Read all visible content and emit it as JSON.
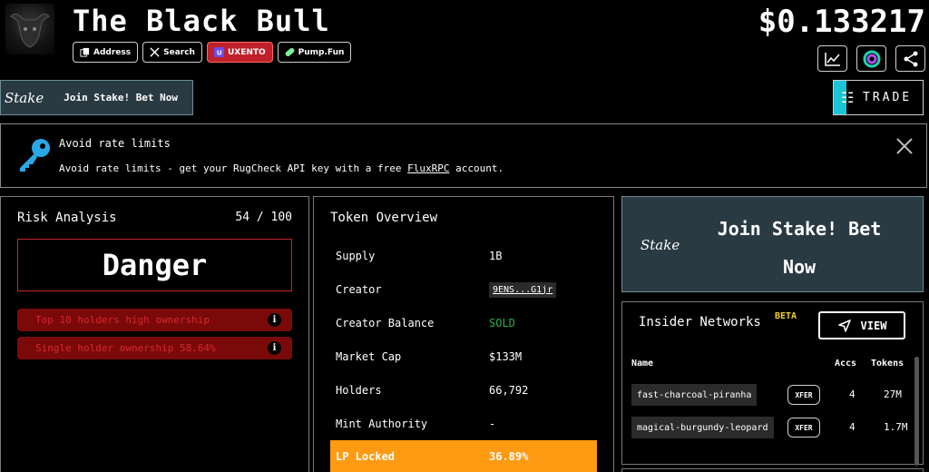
{
  "header": {
    "title": "The Black Bull",
    "price": "$0.133217",
    "chips": [
      {
        "label": "Address",
        "icon": "copy-icon"
      },
      {
        "label": "Search",
        "icon": "x-logo-icon"
      },
      {
        "label": "UXENTO",
        "icon": "uxento-logo-icon"
      },
      {
        "label": "Pump.Fun",
        "icon": "pill-icon"
      }
    ],
    "icon_buttons": [
      "chart-icon",
      "ring-logo-icon",
      "share-icon"
    ]
  },
  "stake_banner_small": {
    "logo": "Stake",
    "text": "Join Stake! Bet Now"
  },
  "trade_button": {
    "label": "TRADE"
  },
  "notice": {
    "title": "Avoid rate limits",
    "body_prefix": "Avoid rate limits - get your RugCheck API key with a free ",
    "link": "FluxRPC",
    "body_suffix": " account."
  },
  "risk": {
    "title": "Risk Analysis",
    "score": "54 / 100",
    "level": "Danger",
    "warnings": [
      "Top 10 holders high ownership",
      "Single holder ownership 58.64%"
    ]
  },
  "overview": {
    "title": "Token Overview",
    "rows": [
      {
        "key": "Supply",
        "value": "1B"
      },
      {
        "key": "Creator",
        "value": "9ENS...G1jr"
      },
      {
        "key": "Creator Balance",
        "value": "SOLD"
      },
      {
        "key": "Market Cap",
        "value": "$133M"
      },
      {
        "key": "Holders",
        "value": "66,792"
      },
      {
        "key": "Mint Authority",
        "value": "-"
      },
      {
        "key": "LP Locked",
        "value": "36.89%"
      }
    ]
  },
  "stake_banner_big": {
    "logo": "Stake",
    "text": "Join Stake! Bet Now"
  },
  "insider": {
    "title": "Insider Networks",
    "beta": "BETA",
    "view_label": "VIEW",
    "columns": {
      "name": "Name",
      "accs": "Accs",
      "tokens": "Tokens"
    },
    "rows": [
      {
        "name": "fast-charcoal-piranha",
        "action": "XFER",
        "accs": "4",
        "tokens": "27M"
      },
      {
        "name": "magical-burgundy-leopard",
        "action": "XFER",
        "accs": "4",
        "tokens": "1.7M"
      }
    ]
  },
  "colors": {
    "danger": "#c2242a",
    "warn_bg": "#7a0a0a",
    "green": "#21b14a",
    "orange": "#ff9a12",
    "stake_bg": "#2a3a42",
    "trade_accent": "#19c5d6",
    "beta": "#f2d21e"
  }
}
